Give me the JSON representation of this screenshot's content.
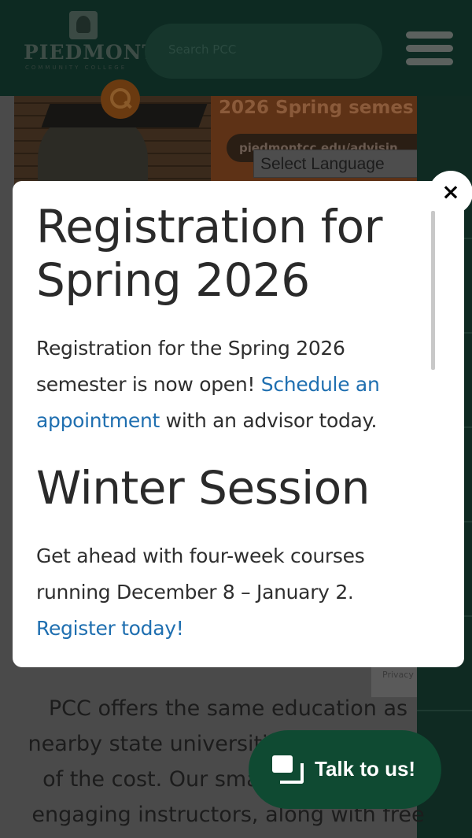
{
  "header": {
    "logo_text": "PIEDMONT",
    "logo_subtext": "COMMUNITY COLLEGE",
    "search_placeholder": "Search PCC",
    "menu_icon": "hamburger-menu-icon",
    "search_icon": "search-icon"
  },
  "hero": {
    "title": "2026 Spring semes",
    "url": "piedmontcc.edu/advisin"
  },
  "language_select": {
    "label": "Select Language",
    "arrow": "▼"
  },
  "modal": {
    "heading1": "Registration for Spring 2026",
    "para1_text1": "Registration for the Spring 2026 semester is now open! ",
    "para1_link": "Schedule an appointment",
    "para1_text2": " with an advisor today.",
    "heading2": "Winter Session",
    "para2_text": "Get ahead with four-week courses running December 8 – January 2. ",
    "para2_link": "Register today!",
    "close_label": "×",
    "link_color": "#1f6fb0"
  },
  "page": {
    "body_text": "PCC offers the same education as nearby state universities at a fraction of the cost. Our small classes have engaging instructors, along with free"
  },
  "recaptcha": {
    "label": "Privacy"
  },
  "chat": {
    "label": "Talk to us!",
    "icon": "chat-bubbles-icon",
    "color": "#0f4a32"
  }
}
